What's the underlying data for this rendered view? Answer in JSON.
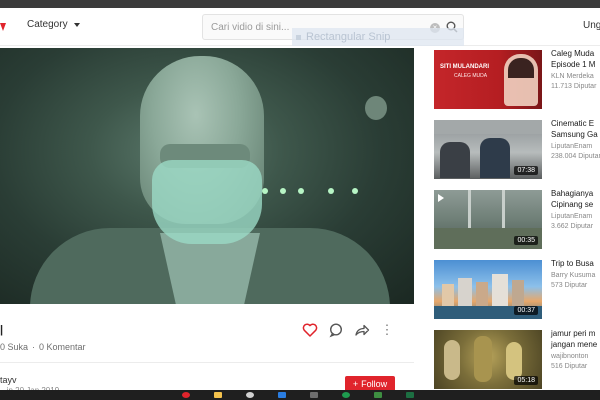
{
  "header": {
    "category_label": "Category",
    "search_placeholder": "Cari vidio di sini...",
    "right_label": "Ung"
  },
  "snip_overlay": "Rectangular Snip",
  "video": {
    "title_mark": "|",
    "likes": "0 Suka",
    "separator": "·",
    "comments": "0 Komentar",
    "channel": "tayv",
    "upload_date": "...in 20 Jan 2019",
    "follow_label": "Follow"
  },
  "related": [
    {
      "title": "Caleg Muda",
      "subtitle": "Episode 1 M",
      "channel": "KLN Merdeka",
      "views": "11.713 Diputar",
      "duration": "",
      "thumb_text": "SITI MULANDARI",
      "thumb_sub": "CALEG MUDA"
    },
    {
      "title": "Cinematic E",
      "subtitle": "Samsung Ga",
      "channel": "LiputanEnam",
      "views": "238.004 Diputar",
      "duration": "07:38"
    },
    {
      "title": "Bahagianya",
      "subtitle": "Cipinang se",
      "channel": "LiputanEnam",
      "views": "3.662 Diputar",
      "duration": "00:35"
    },
    {
      "title": "Trip to Busa",
      "subtitle": "",
      "channel": "Barry Kusuma",
      "views": "573 Diputar",
      "duration": "00:37"
    },
    {
      "title": "jamur peri m",
      "subtitle": "jangan mene",
      "channel": "wajibnonton",
      "views": "516 Diputar",
      "duration": "05:18"
    }
  ],
  "colors": {
    "brand_red": "#e0242c",
    "night_vision": "#9bd9c5"
  }
}
